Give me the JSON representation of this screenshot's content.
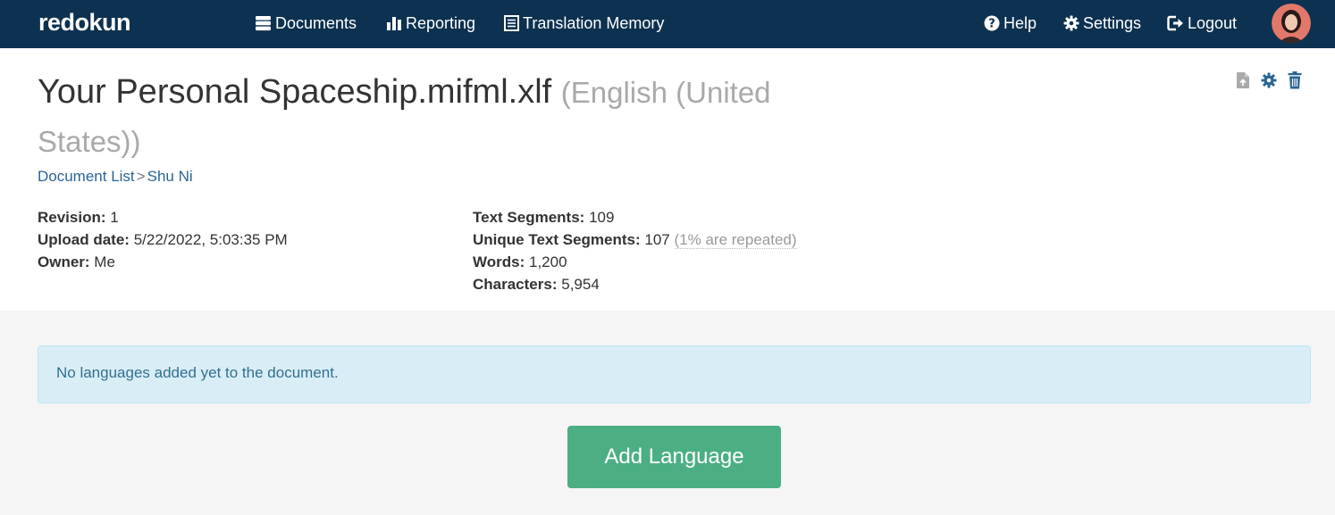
{
  "nav": {
    "brand": "redokun",
    "documents": "Documents",
    "reporting": "Reporting",
    "translation_memory": "Translation Memory",
    "help": "Help",
    "settings": "Settings",
    "logout": "Logout"
  },
  "document": {
    "title": "Your Personal Spaceship.mifml.xlf",
    "language": "(English (United States))",
    "breadcrumb": {
      "list": "Document List",
      "separator": ">",
      "current": "Shu Ni"
    },
    "meta_left": [
      {
        "label": "Revision:",
        "value": "1"
      },
      {
        "label": "Upload date:",
        "value": "5/22/2022, 5:03:35 PM"
      },
      {
        "label": "Owner:",
        "value": "Me"
      }
    ],
    "meta_right": [
      {
        "label": "Text Segments:",
        "value": "109"
      },
      {
        "label": "Unique Text Segments:",
        "value": "107",
        "note": "(1% are repeated)"
      },
      {
        "label": "Words:",
        "value": "1,200"
      },
      {
        "label": "Characters:",
        "value": "5,954"
      }
    ]
  },
  "alert": {
    "text": "No languages added yet to the document."
  },
  "add_language_label": "Add Language",
  "colors": {
    "navbar": "#0d3150",
    "link": "#2a6496",
    "alert_bg": "#d9edf7",
    "alert_text": "#31708f",
    "button": "#4caf84"
  },
  "icons": {
    "documents": "server-stack-icon",
    "reporting": "bar-chart-icon",
    "translation_memory": "list-icon",
    "help": "question-circle-icon",
    "settings": "gear-icon",
    "logout": "logout-icon",
    "export": "file-export-icon",
    "doc_settings": "gear-icon",
    "delete": "trash-icon"
  }
}
